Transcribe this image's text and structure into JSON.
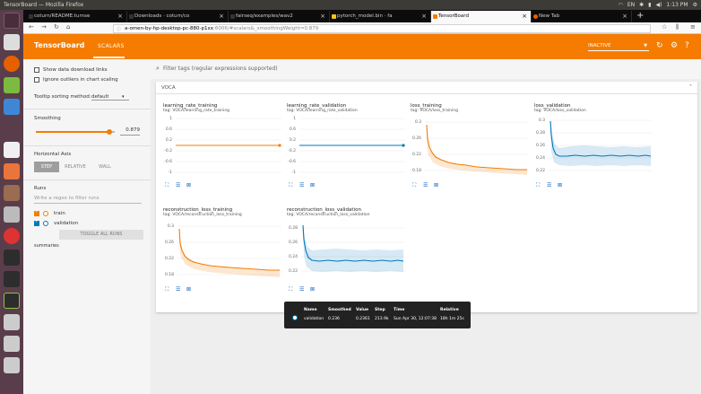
{
  "os": {
    "window_title": "TensorBoard — Mozilla Firefox",
    "clock": "1:13 PM",
    "tray": [
      "wifi-icon",
      "keyboard-indicator",
      "bluetooth-icon",
      "battery-icon",
      "volume-icon"
    ],
    "tray_kb": "EN"
  },
  "browser": {
    "tabs": [
      {
        "label": "coturn/README.turnse",
        "active": false,
        "fav_color": "#333333"
      },
      {
        "label": "Downloads · coturn/co",
        "active": false,
        "fav_color": "#333333"
      },
      {
        "label": "fairseq/examples/wav2",
        "active": false,
        "fav_color": "#333333"
      },
      {
        "label": "pytorch_model.bin · fa",
        "active": false,
        "fav_color": "#f5c518"
      },
      {
        "label": "TensorBoard",
        "active": true,
        "fav_color": "#f57c00"
      },
      {
        "label": "New Tab",
        "active": false,
        "fav_color": "#e66000"
      }
    ],
    "url_host": "a-omen-by-hp-desktop-pc-880-p1xx",
    "url_path": ":6006/#scalars&_smoothingWeight=0.879"
  },
  "tb": {
    "brand": "TensorBoard",
    "tab_scalars": "SCALARS",
    "inactive_label": "INACTIVE",
    "accent": "#f57c00"
  },
  "sidebar": {
    "show_download": "Show data download links",
    "ignore_outliers": "Ignore outliers in chart scaling",
    "tooltip_sort_label": "Tooltip sorting method:",
    "tooltip_sort_value": "default",
    "smoothing_label": "Smoothing",
    "smoothing_value": "0.879",
    "smoothing_fraction": 0.879,
    "haxis_label": "Horizontal Axis",
    "haxis_options": [
      "STEP",
      "RELATIVE",
      "WALL"
    ],
    "runs_label": "Runs",
    "regex_placeholder": "Write a regex to filter runs",
    "runs": [
      {
        "name": "train",
        "color": "#f57c00"
      },
      {
        "name": "validation",
        "color": "#0277bd"
      }
    ],
    "toggle_all": "TOGGLE ALL RUNS",
    "summaries": "summaries"
  },
  "main": {
    "filter_placeholder": "Filter tags (regular expressions supported)",
    "group": "VOCA",
    "panels": [
      {
        "title": "learning_rate_training",
        "tag": "tag: VOCA/learning_rate_training",
        "yticks": [
          "1",
          "0.6",
          "0.2",
          "-0.2",
          "-0.6",
          "-1"
        ]
      },
      {
        "title": "learning_rate_validation",
        "tag": "tag: VOCA/learning_rate_validation",
        "yticks": [
          "1",
          "0.6",
          "0.2",
          "-0.2",
          "-0.6",
          "-1"
        ]
      },
      {
        "title": "loss_training",
        "tag": "tag: VOCA/loss_training",
        "yticks": [
          "0.3",
          "0.26",
          "0.22",
          "0.18"
        ]
      },
      {
        "title": "loss_validation",
        "tag": "tag: VOCA/loss_validation",
        "yticks": [
          "0.3",
          "0.28",
          "0.26",
          "0.24",
          "0.22"
        ]
      },
      {
        "title": "reconstruction_loss_training",
        "tag": "tag: VOCA/reconstruction_loss_training",
        "yticks": [
          "0.3",
          "0.26",
          "0.22",
          "0.18"
        ]
      },
      {
        "title": "reconstruction_loss_validation",
        "tag": "tag: VOCA/reconstruction_loss_validation",
        "yticks": [
          "0.28",
          "0.26",
          "0.24",
          "0.22"
        ]
      }
    ]
  },
  "tooltip": {
    "headers": [
      "Name",
      "Smoothed",
      "Value",
      "Step",
      "Time",
      "Relative"
    ],
    "row": [
      "validation",
      "0.236",
      "0.2361",
      "213.9k",
      "Sun Apr 30, 12:07:38",
      "18h 1m 25s"
    ]
  }
}
